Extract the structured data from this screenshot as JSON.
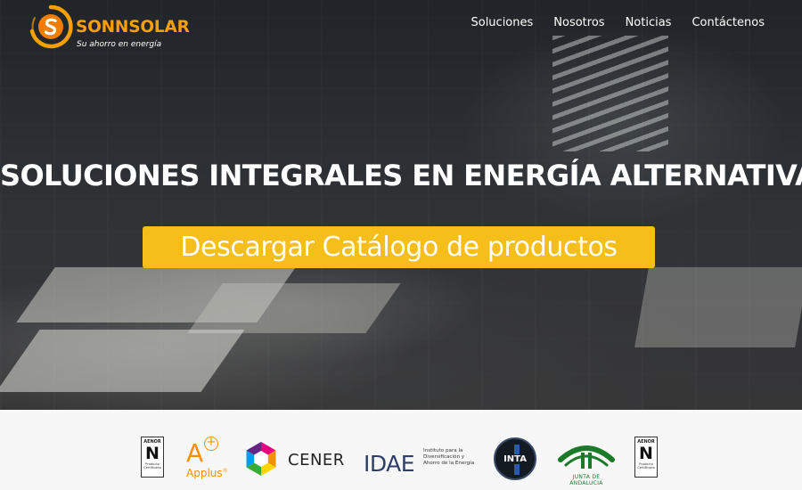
{
  "brand": {
    "name": "SONNSOLAR",
    "tagline": "Su ahorro en energía",
    "colors": {
      "primary": "#f5a000",
      "cta": "#f5be1b"
    }
  },
  "nav": {
    "items": [
      "Soluciones",
      "Nosotros",
      "Noticias",
      "Contáctenos"
    ]
  },
  "hero": {
    "title": "SOLUCIONES INTEGRALES EN ENERGÍA ALTERNATIVA",
    "cta_label": "Descargar Catálogo de productos"
  },
  "partners": {
    "aenor": {
      "top": "AENOR",
      "letter": "N",
      "subtitle": "Producto Certificado"
    },
    "applus": {
      "letter": "A",
      "plus": "+",
      "word": "Applus",
      "mark": "®"
    },
    "cener": {
      "word": "CENER"
    },
    "idae": {
      "word": "IDAE",
      "subtitle": "Instituto para la Diversificación y Ahorro de la Energía"
    },
    "inta": {
      "word": "INTA"
    },
    "junta": {
      "word": "JUNTA DE ANDALUCIA"
    }
  }
}
